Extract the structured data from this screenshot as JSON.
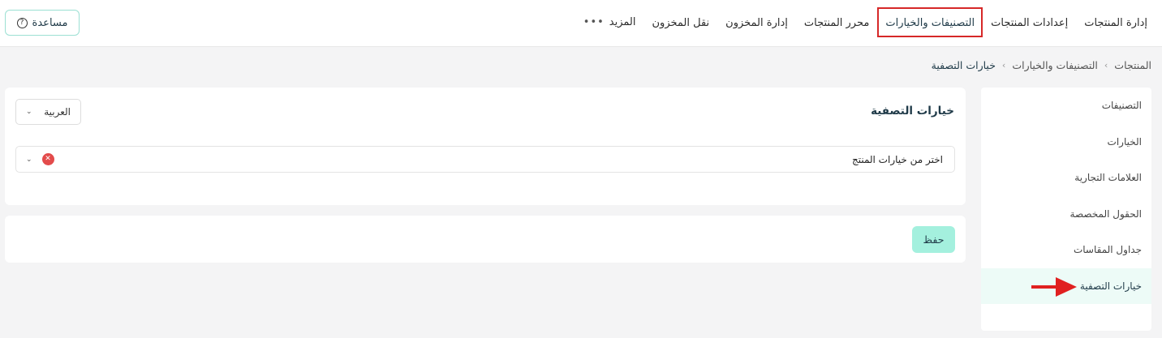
{
  "topnav": {
    "items": [
      {
        "label": "إدارة المنتجات"
      },
      {
        "label": "إعدادات المنتجات"
      },
      {
        "label": "التصنيفات والخيارات"
      },
      {
        "label": "محرر المنتجات"
      },
      {
        "label": "إدارة المخزون"
      },
      {
        "label": "نقل المخزون"
      }
    ],
    "more_label": "المزيد",
    "more_icon": "ellipsis-icon",
    "active_index": 2,
    "active_border_color": "#d62828"
  },
  "help": {
    "label": "مساعدة",
    "icon": "question-circle-icon",
    "icon_glyph": "?"
  },
  "breadcrumb": {
    "items": [
      "المنتجات",
      "التصنيفات والخيارات",
      "خيارات التصفية"
    ],
    "separator": "›"
  },
  "sidemenu": {
    "items": [
      {
        "label": "التصنيفات"
      },
      {
        "label": "الخيارات"
      },
      {
        "label": "العلامات التجارية"
      },
      {
        "label": "الحقول المخصصة"
      },
      {
        "label": "جداول المقاسات"
      },
      {
        "label": "خيارات التصفية"
      }
    ],
    "active_index": 5,
    "active_bg": "#edfbf7"
  },
  "panel": {
    "title": "خيارات التصفية",
    "language_select": {
      "value": "العربية"
    },
    "options_select": {
      "value": "اختر من خيارات المنتج",
      "clear_glyph": "✕"
    }
  },
  "save": {
    "label": "حفظ",
    "bg_color": "#a4f0de"
  },
  "colors": {
    "accent": "#a4f0de",
    "brand_text": "#1f3a48",
    "annotation_red": "#e02020"
  }
}
